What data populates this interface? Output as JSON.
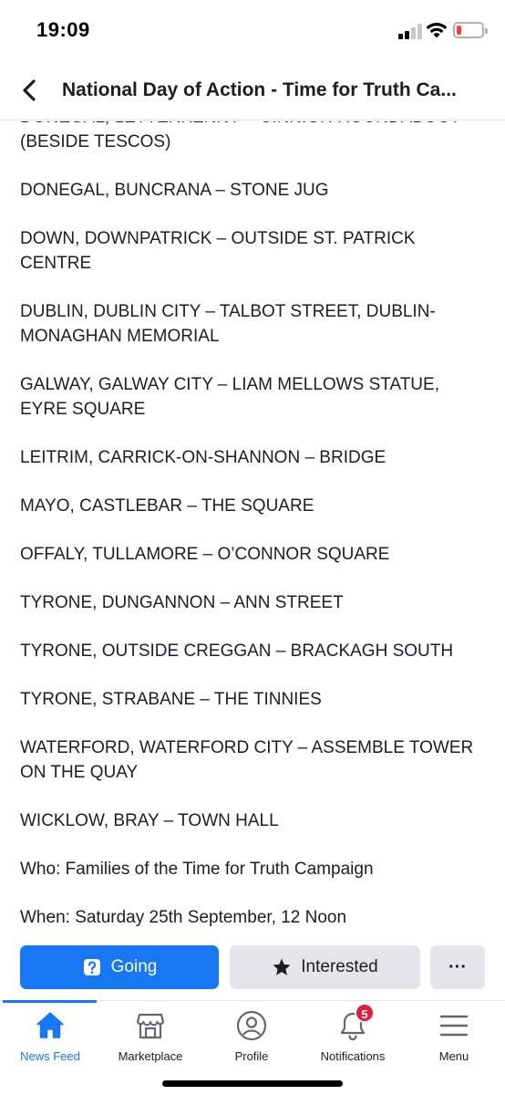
{
  "status_bar": {
    "time": "19:09"
  },
  "header": {
    "title": "National Day of Action - Time for Truth Ca..."
  },
  "content": {
    "lines": [
      {
        "first": "DONEGAL, LETTERKENNY – CINNIGH ROUNDABOUT",
        "rest": "(BESIDE TESCOS)"
      },
      {
        "first": "DONEGAL, BUNCRANA – STONE JUG"
      },
      {
        "first": "DOWN, DOWNPATRICK – OUTSIDE ST. PATRICK",
        "rest": "CENTRE"
      },
      {
        "first": "DUBLIN, DUBLIN CITY – TALBOT STREET, DUBLIN-",
        "rest": "MONAGHAN MEMORIAL"
      },
      {
        "first": "GALWAY, GALWAY CITY – LIAM MELLOWS STATUE,",
        "rest": "EYRE SQUARE"
      },
      {
        "first": "LEITRIM, CARRICK-ON-SHANNON – BRIDGE"
      },
      {
        "first": "MAYO, CASTLEBAR – THE SQUARE"
      },
      {
        "first": "OFFALY, TULLAMORE – O’CONNOR SQUARE"
      },
      {
        "first": "TYRONE, DUNGANNON – ANN STREET"
      },
      {
        "first": "TYRONE, OUTSIDE CREGGAN – BRACKAGH SOUTH"
      },
      {
        "first": "TYRONE, STRABANE – THE TINNIES"
      },
      {
        "first": "WATERFORD, WATERFORD CITY – ASSEMBLE TOWER",
        "rest": "ON THE QUAY"
      },
      {
        "first": "WICKLOW, BRAY – TOWN HALL"
      },
      {
        "first": "Who: Families of the Time for Truth Campaign"
      },
      {
        "first": "When: Saturday 25th September, 12 Noon"
      }
    ]
  },
  "actions": {
    "going_label": "Going",
    "interested_label": "Interested",
    "more_label": "···"
  },
  "tabs": [
    {
      "label": "News Feed",
      "icon": "home-icon",
      "active": true
    },
    {
      "label": "Marketplace",
      "icon": "marketplace-icon"
    },
    {
      "label": "Profile",
      "icon": "profile-icon"
    },
    {
      "label": "Notifications",
      "icon": "bell-icon",
      "badge": "5"
    },
    {
      "label": "Menu",
      "icon": "menu-icon"
    }
  ],
  "colors": {
    "accent": "#1877f2",
    "badge": "#e41e3f",
    "button_secondary": "#e4e6eb"
  }
}
